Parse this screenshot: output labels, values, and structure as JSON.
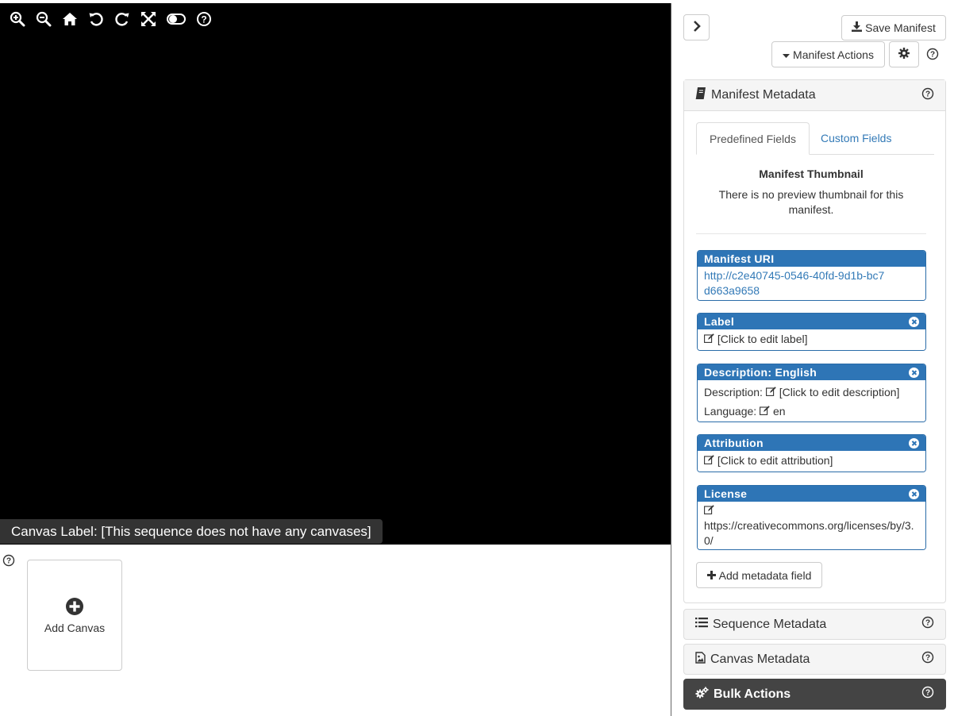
{
  "viewer": {
    "toolbar": [
      "zoom-in-icon",
      "zoom-out-icon",
      "home-icon",
      "rotate-left-icon",
      "rotate-right-icon",
      "fullscreen-icon",
      "toggle-icon",
      "help-icon"
    ],
    "canvas_label": "Canvas Label: [This sequence does not have any canvases]"
  },
  "canvas_strip": {
    "add_canvas_label": "Add Canvas"
  },
  "sidebar": {
    "save_label": "Save Manifest",
    "actions_label": "Manifest Actions",
    "manifest_metadata": {
      "title": "Manifest Metadata",
      "tabs": [
        "Predefined Fields",
        "Custom Fields"
      ],
      "thumbnail_title": "Manifest Thumbnail",
      "thumbnail_text": "There is no preview thumbnail for this manifest.",
      "fields": {
        "uri": {
          "label": "Manifest URI",
          "value": "http://c2e40745-0546-40fd-9d1b-bc7d663a9658"
        },
        "label": {
          "label": "Label",
          "value": "[Click to edit label]"
        },
        "description": {
          "label": "Description: English",
          "desc_prefix": "Description:",
          "desc_value": "[Click to edit description]",
          "lang_prefix": "Language:",
          "lang_value": "en"
        },
        "attribution": {
          "label": "Attribution",
          "value": "[Click to edit attribution]"
        },
        "license": {
          "label": "License",
          "value": "https://creativecommons.org/licenses/by/3.0/"
        }
      },
      "add_field_label": "Add metadata field"
    },
    "sequence_metadata": "Sequence Metadata",
    "canvas_metadata": "Canvas Metadata",
    "bulk_actions": "Bulk Actions"
  },
  "colors": {
    "field_header": "#2e75b6",
    "link": "#337ab7",
    "dark_panel": "#444444"
  }
}
